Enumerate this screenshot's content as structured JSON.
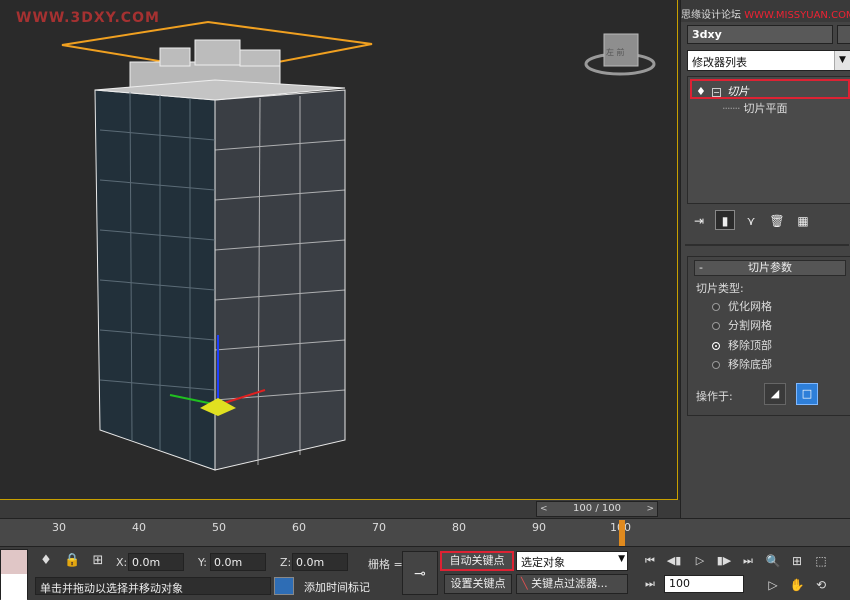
{
  "watermark": {
    "top_left": "WWW.3DXY.COM",
    "top_right_part1": "思缘设计论坛",
    "top_right_part2": "WWW.MISSYUAN.COM"
  },
  "viewport": {
    "viewcube_text": "左 前"
  },
  "command_panel": {
    "object_name": "3dxy",
    "modifier_list": "修改器列表",
    "stack": {
      "modifier": "切片",
      "sub_object": "切片平面"
    },
    "rollout": {
      "title": "切片参数",
      "slice_type_label": "切片类型:",
      "options": [
        "优化网格",
        "分割网格",
        "移除顶部",
        "移除底部"
      ],
      "selected_option": "移除顶部",
      "operate_on_label": "操作于:"
    }
  },
  "timeline": {
    "slider_text": "100 / 100",
    "prev_arrow": "<",
    "next_arrow": ">",
    "ticks": [
      "30",
      "40",
      "50",
      "60",
      "70",
      "80",
      "90",
      "100"
    ]
  },
  "status_bar": {
    "x_label": "X:",
    "x_value": "0.0m",
    "y_label": "Y:",
    "y_value": "0.0m",
    "z_label": "Z:",
    "z_value": "0.0m",
    "grid_label": "栅格 =",
    "prompt_text": "单击并拖动以选择并移动对象",
    "add_time_tag": "添加时间标记",
    "auto_key": "自动关键点",
    "set_key": "设置关键点",
    "key_selection": "选定对象",
    "key_filters": "关键点过滤器...",
    "current_frame": "100"
  },
  "colors": {
    "accent_orange": "#e08a1e",
    "highlight_red": "#dd2233",
    "active_blue": "#2e7fd9"
  }
}
